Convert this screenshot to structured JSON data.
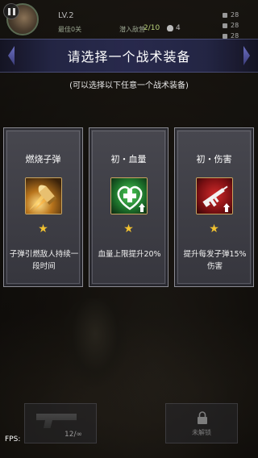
{
  "hud": {
    "level": "LV.2",
    "best_label": "最佳0关",
    "kills_label": "潜入敌营",
    "kills_value": "2/10",
    "deaths_value": "4",
    "right_stats": [
      "28",
      "28",
      "28"
    ]
  },
  "dialog": {
    "title": "请选择一个战术装备",
    "subtitle": "(可以选择以下任意一个战术装备)",
    "cards": [
      {
        "name": "燃烧子弹",
        "icon": "burning-bullet-icon",
        "stars": "★",
        "description": "子弹引燃敌人持续一段时间"
      },
      {
        "name": "初・血量",
        "icon": "health-heart-icon",
        "stars": "★",
        "description": "血量上限提升20%"
      },
      {
        "name": "初・伤害",
        "icon": "damage-rifle-icon",
        "stars": "★",
        "description": "提升每发子弹15%伤害"
      }
    ]
  },
  "bottom": {
    "ammo": "12/∞",
    "locked_label": "未解锁",
    "fps_label": "FPS:"
  },
  "colors": {
    "star": "#f2c230",
    "banner": "#282a4e",
    "kills_value": "#b9d27a"
  }
}
